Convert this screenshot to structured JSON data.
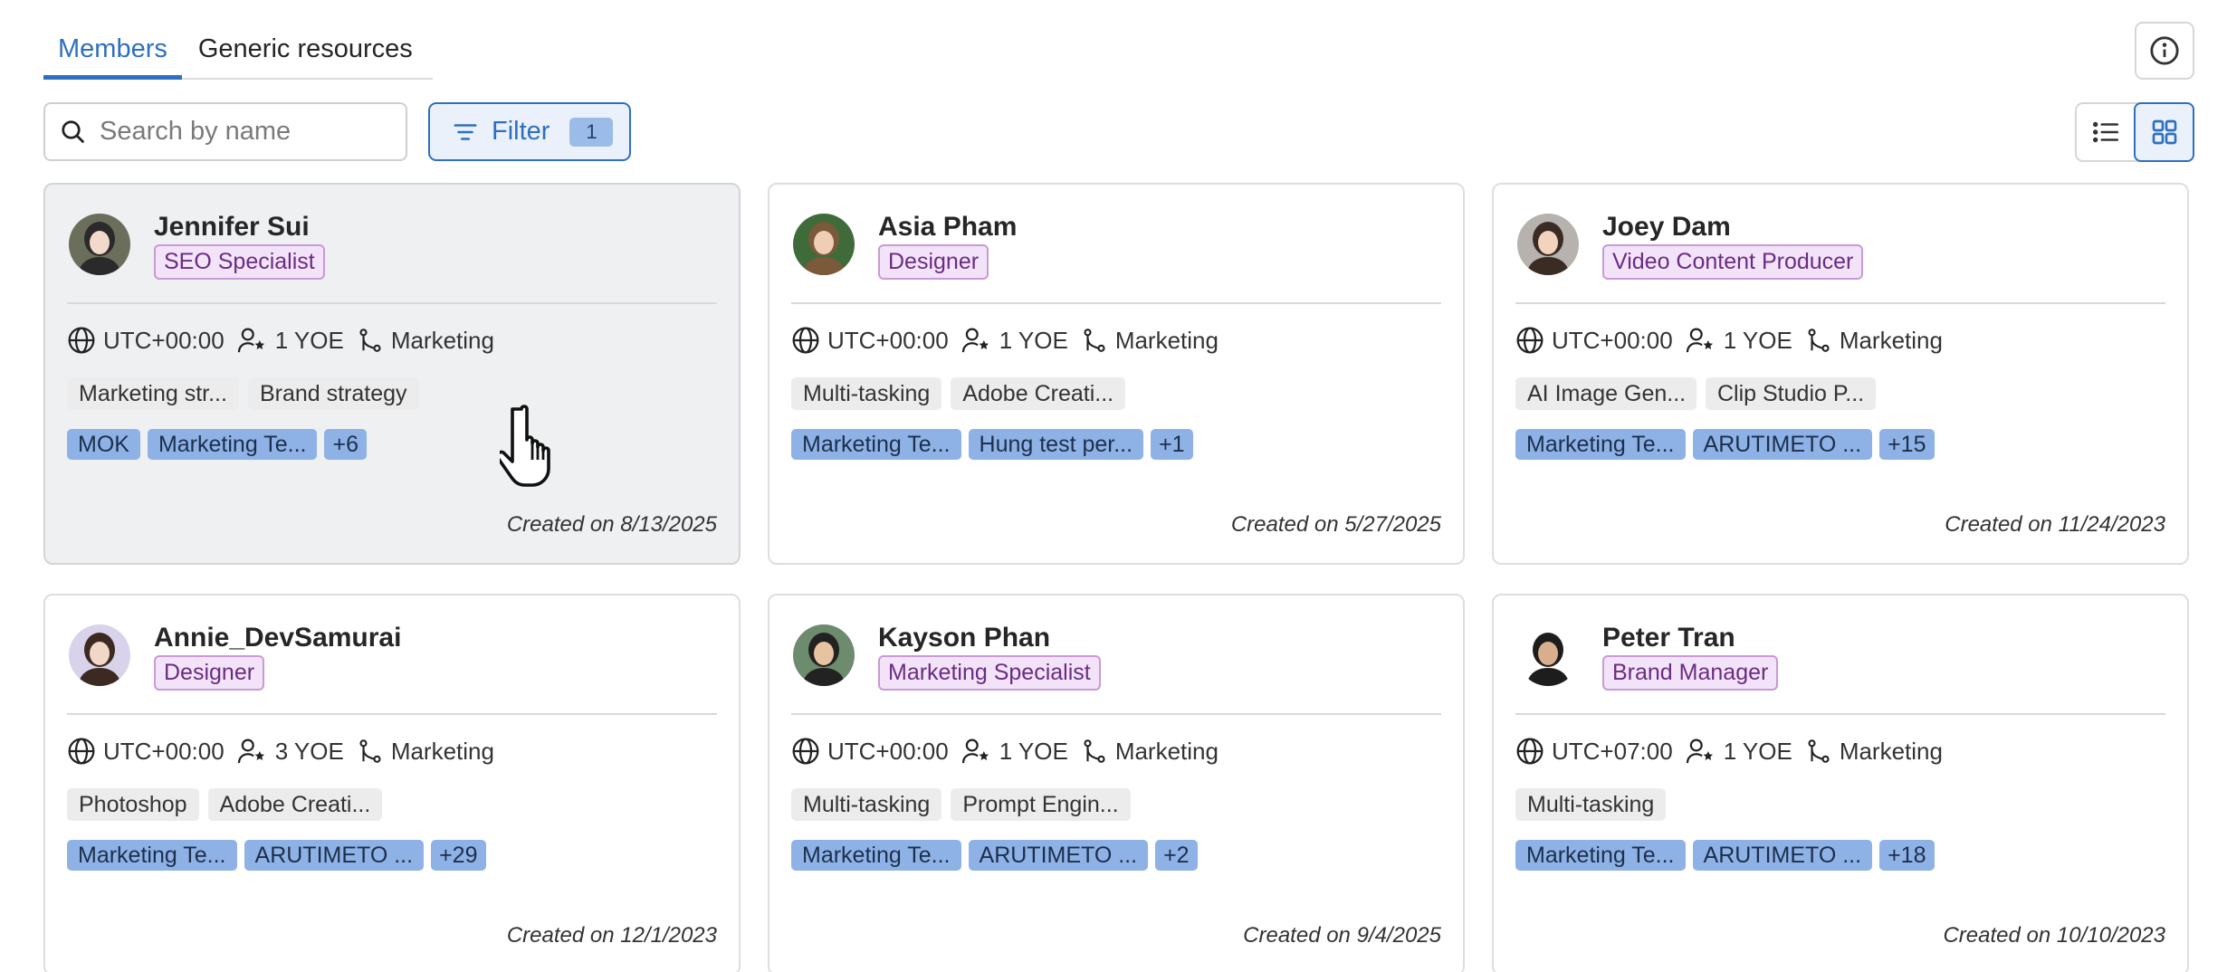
{
  "tabs": [
    {
      "label": "Members",
      "active": true
    },
    {
      "label": "Generic resources",
      "active": false
    }
  ],
  "search": {
    "placeholder": "Search by name"
  },
  "filter": {
    "label": "Filter",
    "count": "1"
  },
  "view": {
    "mode": "grid"
  },
  "colors": {
    "accent": "#2f6fbf",
    "role_bg": "#f3e3f9",
    "team_bg": "#8fb2e6",
    "skill_bg": "#ececec"
  },
  "members": [
    {
      "name": "Jennifer Sui",
      "role": "SEO Specialist",
      "timezone": "UTC+00:00",
      "yoe": "1 YOE",
      "department": "Marketing",
      "skills": [
        "Marketing str...",
        "Brand strategy"
      ],
      "teams": [
        "MOK",
        "Marketing Te...",
        "+6"
      ],
      "created": "Created on 8/13/2025"
    },
    {
      "name": "Asia Pham",
      "role": "Designer",
      "timezone": "UTC+00:00",
      "yoe": "1 YOE",
      "department": "Marketing",
      "skills": [
        "Multi-tasking",
        "Adobe Creati..."
      ],
      "teams": [
        "Marketing Te...",
        "Hung test per...",
        "+1"
      ],
      "created": "Created on 5/27/2025"
    },
    {
      "name": "Joey Dam",
      "role": "Video Content Producer",
      "timezone": "UTC+00:00",
      "yoe": "1 YOE",
      "department": "Marketing",
      "skills": [
        "AI Image Gen...",
        "Clip Studio P..."
      ],
      "teams": [
        "Marketing Te...",
        "ARUTIMETO ...",
        "+15"
      ],
      "created": "Created on 11/24/2023"
    },
    {
      "name": "Annie_DevSamurai",
      "role": "Designer",
      "timezone": "UTC+00:00",
      "yoe": "3 YOE",
      "department": "Marketing",
      "skills": [
        "Photoshop",
        "Adobe Creati..."
      ],
      "teams": [
        "Marketing Te...",
        "ARUTIMETO ...",
        "+29"
      ],
      "created": "Created on 12/1/2023"
    },
    {
      "name": "Kayson Phan",
      "role": "Marketing Specialist",
      "timezone": "UTC+00:00",
      "yoe": "1 YOE",
      "department": "Marketing",
      "skills": [
        "Multi-tasking",
        "Prompt Engin..."
      ],
      "teams": [
        "Marketing Te...",
        "ARUTIMETO ...",
        "+2"
      ],
      "created": "Created on 9/4/2025"
    },
    {
      "name": "Peter Tran",
      "role": "Brand Manager",
      "timezone": "UTC+07:00",
      "yoe": "1 YOE",
      "department": "Marketing",
      "skills": [
        "Multi-tasking"
      ],
      "teams": [
        "Marketing Te...",
        "ARUTIMETO ...",
        "+18"
      ],
      "created": "Created on 10/10/2023"
    }
  ]
}
